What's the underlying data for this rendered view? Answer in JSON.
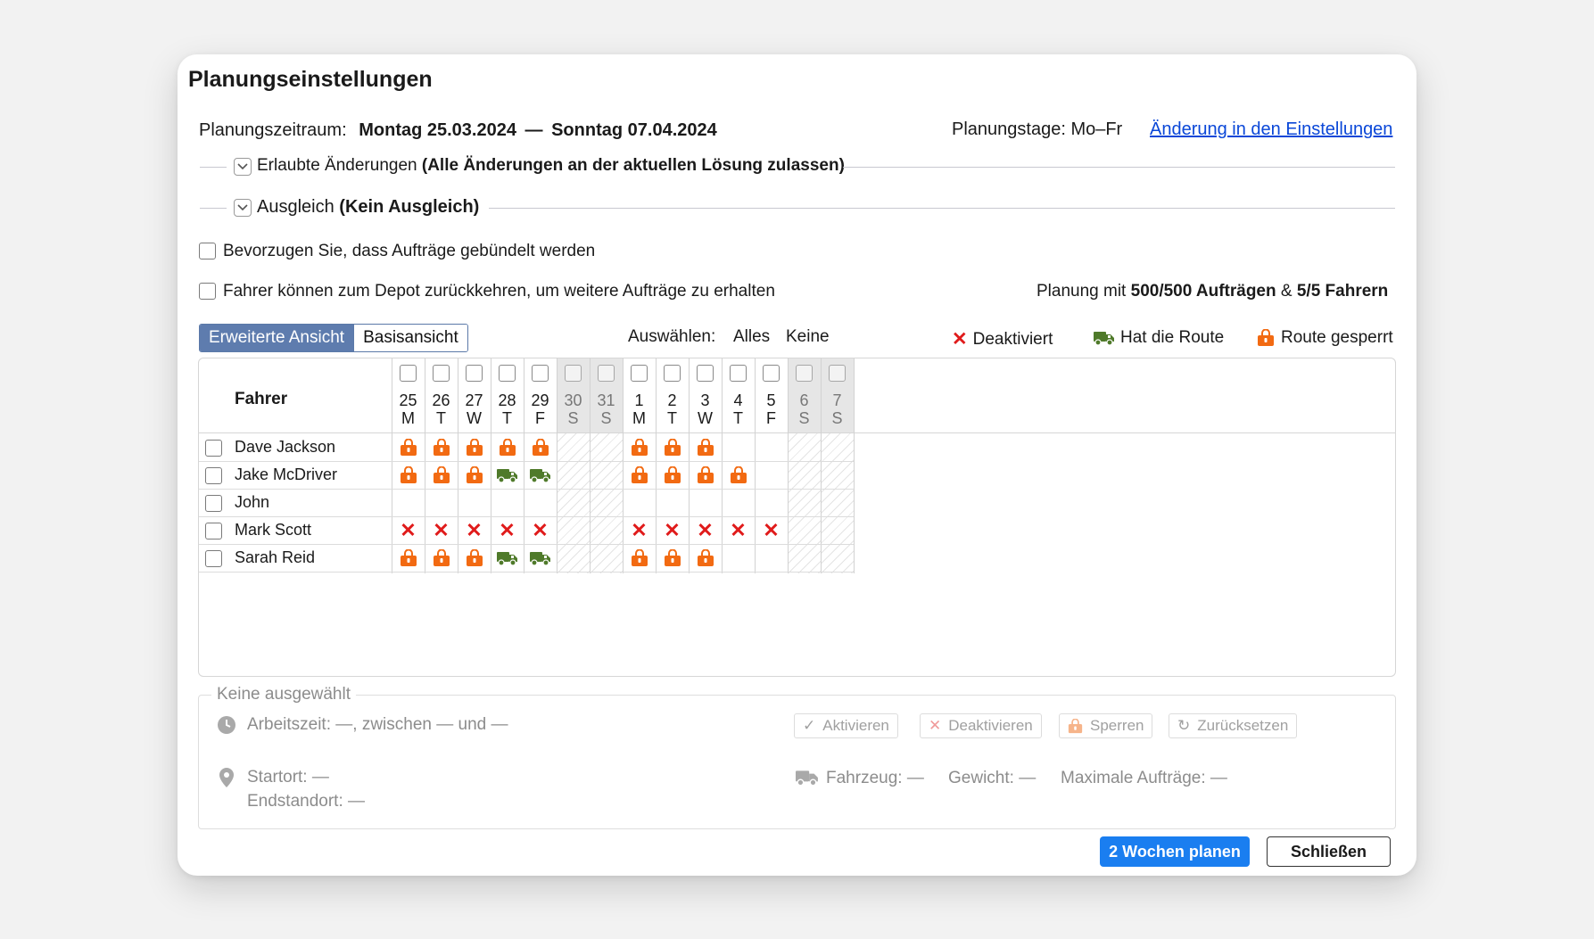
{
  "dialog": {
    "title": "Planungseinstellungen",
    "period_label": "Planungszeitraum:",
    "period_start": "Montag 25.03.2024",
    "period_sep": "—",
    "period_end": "Sonntag 07.04.2024",
    "planning_days": "Planungstage: Mo–Fr",
    "settings_link": "Änderung in den Einstellungen"
  },
  "sections": {
    "allowed_changes_label": "Erlaubte Änderungen",
    "allowed_changes_value": "(Alle Änderungen an der aktuellen Lösung zulassen)",
    "balance_label": "Ausgleich",
    "balance_value": "(Kein Ausgleich)"
  },
  "options": {
    "bundle_orders": "Bevorzugen Sie, dass Aufträge gebündelt werden",
    "return_to_depot": "Fahrer können zum Depot zurückkehren, um weitere Aufträge zu erhalten",
    "summary_prefix": "Planung mit",
    "summary_orders": "500/500 Aufträgen",
    "summary_amp": "&",
    "summary_drivers": "5/5 Fahrern"
  },
  "view_toggle": {
    "advanced": "Erweiterte Ansicht",
    "basic": "Basisansicht"
  },
  "select": {
    "label": "Auswählen:",
    "all": "Alles",
    "none": "Keine"
  },
  "legend": {
    "deactivated": "Deaktiviert",
    "has_route": "Hat die Route",
    "route_locked": "Route gesperrt",
    "color_x": "#e01b1b",
    "color_truck": "#4f7a2a",
    "color_lock": "#f26a12"
  },
  "grid": {
    "driver_header": "Fahrer",
    "days": [
      {
        "num": "25",
        "wd": "M",
        "weekend": false
      },
      {
        "num": "26",
        "wd": "T",
        "weekend": false
      },
      {
        "num": "27",
        "wd": "W",
        "weekend": false
      },
      {
        "num": "28",
        "wd": "T",
        "weekend": false
      },
      {
        "num": "29",
        "wd": "F",
        "weekend": false
      },
      {
        "num": "30",
        "wd": "S",
        "weekend": true
      },
      {
        "num": "31",
        "wd": "S",
        "weekend": true
      },
      {
        "num": "1",
        "wd": "M",
        "weekend": false
      },
      {
        "num": "2",
        "wd": "T",
        "weekend": false
      },
      {
        "num": "3",
        "wd": "W",
        "weekend": false
      },
      {
        "num": "4",
        "wd": "T",
        "weekend": false
      },
      {
        "num": "5",
        "wd": "F",
        "weekend": false
      },
      {
        "num": "6",
        "wd": "S",
        "weekend": true
      },
      {
        "num": "7",
        "wd": "S",
        "weekend": true
      }
    ],
    "drivers": [
      {
        "name": "Dave Jackson",
        "cells": [
          "lock",
          "lock",
          "lock",
          "lock",
          "lock",
          "",
          "",
          "lock",
          "lock",
          "lock",
          "",
          "",
          "",
          ""
        ]
      },
      {
        "name": "Jake McDriver",
        "cells": [
          "lock",
          "lock",
          "lock",
          "truck",
          "truck",
          "",
          "",
          "lock",
          "lock",
          "lock",
          "lock",
          "",
          "",
          ""
        ]
      },
      {
        "name": "John",
        "cells": [
          "",
          "",
          "",
          "",
          "",
          "",
          "",
          "",
          "",
          "",
          "",
          "",
          "",
          ""
        ]
      },
      {
        "name": "Mark Scott",
        "cells": [
          "x",
          "x",
          "x",
          "x",
          "x",
          "",
          "",
          "x",
          "x",
          "x",
          "x",
          "x",
          "",
          ""
        ]
      },
      {
        "name": "Sarah Reid",
        "cells": [
          "lock",
          "lock",
          "lock",
          "truck",
          "truck",
          "",
          "",
          "lock",
          "lock",
          "lock",
          "",
          "",
          "",
          ""
        ]
      }
    ]
  },
  "details": {
    "none_selected": "Keine ausgewählt",
    "work_time": "Arbeitszeit:",
    "work_time_value": "—, zwischen — und —",
    "btn_activate": "Aktivieren",
    "btn_deactivate": "Deaktivieren",
    "btn_lock": "Sperren",
    "btn_reset": "Zurücksetzen",
    "start_location": "Startort:",
    "start_value": "—",
    "end_location": "Endstandort:",
    "end_value": "—",
    "vehicle": "Fahrzeug:",
    "vehicle_value": "—",
    "weight": "Gewicht:",
    "weight_value": "—",
    "max_orders": "Maximale Aufträge:",
    "max_orders_value": "—"
  },
  "footer": {
    "plan_button": "2 Wochen planen",
    "close_button": "Schließen"
  }
}
